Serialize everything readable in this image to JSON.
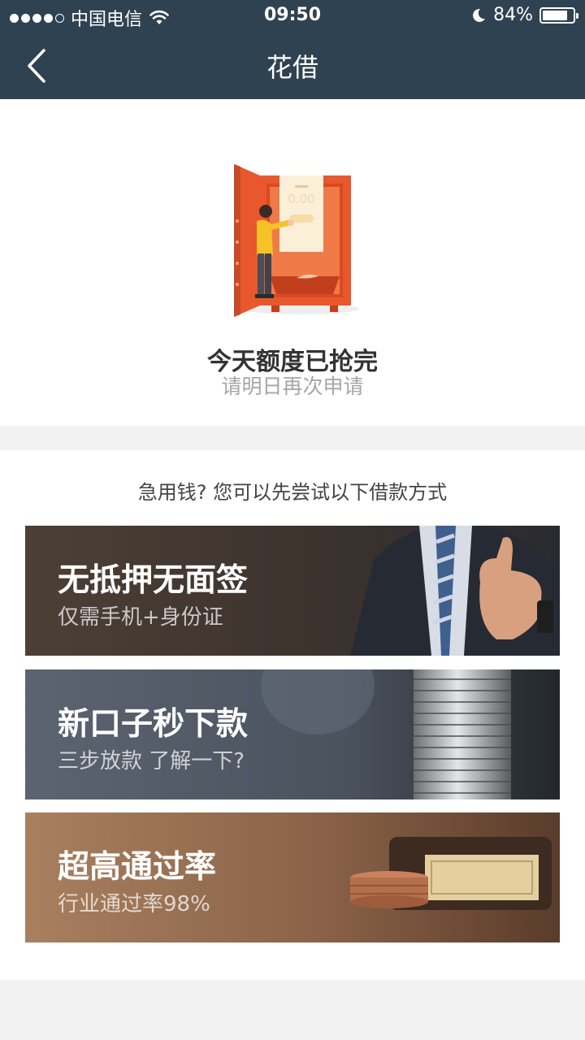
{
  "status_bar": {
    "carrier": "中国电信",
    "time": "09:50",
    "battery": "84%",
    "battery_level": 0.84
  },
  "nav": {
    "title": "花借"
  },
  "notice": {
    "title": "今天额度已抢完",
    "subtitle": "请明日再次申请",
    "amount_display": "0.00"
  },
  "options": {
    "heading": "急用钱? 您可以先尝试以下借款方式",
    "cards": [
      {
        "title": "无抵押无面签",
        "subtitle": "仅需手机+身份证"
      },
      {
        "title": "新口子秒下款",
        "subtitle": "三步放款 了解一下?"
      },
      {
        "title": "超高通过率",
        "subtitle": "行业通过率98%"
      }
    ]
  },
  "colors": {
    "header": "#2f4252",
    "safe": "#e8582c",
    "card1": "#4a3d34",
    "card2": "#5c6673",
    "card3": "#a57c5c"
  }
}
